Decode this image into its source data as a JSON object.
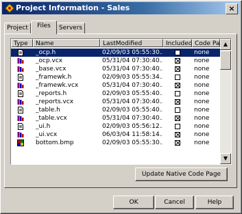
{
  "window": {
    "title": "Project Information - Sales",
    "close_label": "×"
  },
  "tabs": [
    {
      "label": "Project",
      "active": false
    },
    {
      "label": "Files",
      "active": true
    },
    {
      "label": "Servers",
      "active": false
    }
  ],
  "list": {
    "columns": [
      "Type",
      "Name",
      "LastModified",
      "Included",
      "Code Page"
    ],
    "rows": [
      {
        "icon": "document-icon",
        "name": "_ocp.h",
        "modified": "02/09/03 05:55:30...",
        "included": false,
        "codepage": "none",
        "selected": true
      },
      {
        "icon": "class-library-icon",
        "name": "_ocp.vcx",
        "modified": "05/31/04 07:30:40...",
        "included": true,
        "codepage": "none"
      },
      {
        "icon": "class-library-icon",
        "name": "_base.vcx",
        "modified": "05/31/04 07:30:40...",
        "included": true,
        "codepage": "none"
      },
      {
        "icon": "document-icon",
        "name": "_framewk.h",
        "modified": "02/09/03 05:55:34...",
        "included": false,
        "codepage": "none"
      },
      {
        "icon": "class-library-icon",
        "name": "_framewk.vcx",
        "modified": "05/31/04 07:30:40...",
        "included": true,
        "codepage": "none"
      },
      {
        "icon": "document-icon",
        "name": "_reports.h",
        "modified": "02/09/03 05:55:40...",
        "included": false,
        "codepage": "none"
      },
      {
        "icon": "class-library-icon",
        "name": "_reports.vcx",
        "modified": "05/31/04 07:30:40...",
        "included": true,
        "codepage": "none"
      },
      {
        "icon": "document-icon",
        "name": "_table.h",
        "modified": "02/09/03 05:55:40...",
        "included": false,
        "codepage": "none"
      },
      {
        "icon": "class-library-icon",
        "name": "_table.vcx",
        "modified": "05/31/04 07:30:40...",
        "included": true,
        "codepage": "none"
      },
      {
        "icon": "document-icon",
        "name": "_ui.h",
        "modified": "02/09/03 05:56:12...",
        "included": false,
        "codepage": "none"
      },
      {
        "icon": "class-library-icon",
        "name": "_ui.vcx",
        "modified": "06/03/04 11:58:14...",
        "included": true,
        "codepage": "none"
      },
      {
        "icon": "bitmap-icon",
        "name": "bottom.bmp",
        "modified": "02/09/03 05:55:30...",
        "included": true,
        "codepage": "none"
      }
    ]
  },
  "buttons": {
    "update_code_page": "Update Native Code Page",
    "ok": "OK",
    "cancel": "Cancel",
    "help": "Help"
  },
  "colors": {
    "selection": "#0a246a",
    "title_start": "#0a246a",
    "title_end": "#a6caf0"
  }
}
